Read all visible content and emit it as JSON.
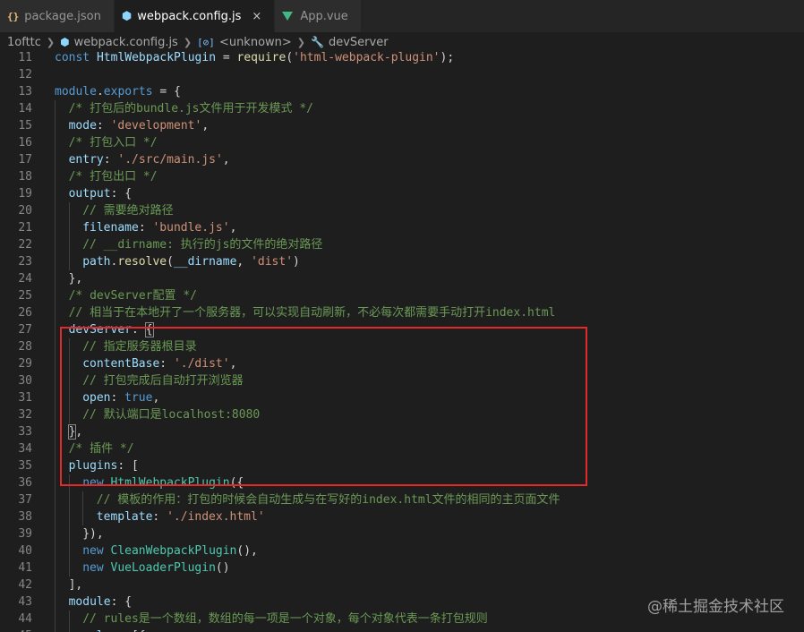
{
  "tabs": [
    {
      "label": "package.json",
      "icon": "json-icon",
      "active": false
    },
    {
      "label": "webpack.config.js",
      "icon": "webpack-icon",
      "active": true
    },
    {
      "label": "App.vue",
      "icon": "vue-icon",
      "active": false
    }
  ],
  "icons": {
    "json_glyph": "{}",
    "webpack_glyph": "⬢",
    "unknown_glyph": "[⊘]",
    "wrench_glyph": "🔧",
    "close_glyph": "×"
  },
  "breadcrumbs": [
    "1ofttc",
    "webpack.config.js",
    "<unknown>",
    "devServer"
  ],
  "colors": {
    "background": "#1e1e1e",
    "keyword": "#569cd6",
    "string": "#ce9178",
    "comment": "#6a9955",
    "class": "#4ec9b0",
    "function": "#dcdcaa",
    "highlight_box": "#e32a2a"
  },
  "code_lines": [
    {
      "n": "11",
      "indent": 0,
      "tokens": [
        [
          "kw",
          "const "
        ],
        [
          "var",
          "HtmlWebpackPlugin"
        ],
        [
          "p",
          " = "
        ],
        [
          "fn",
          "require"
        ],
        [
          "p",
          "("
        ],
        [
          "str",
          "'html-webpack-plugin'"
        ],
        [
          "p",
          ");"
        ]
      ]
    },
    {
      "n": "12",
      "indent": 0,
      "tokens": []
    },
    {
      "n": "13",
      "indent": 0,
      "tokens": [
        [
          "kw",
          "module"
        ],
        [
          "p",
          "."
        ],
        [
          "kw",
          "exports"
        ],
        [
          "p",
          " = {"
        ]
      ]
    },
    {
      "n": "14",
      "indent": 1,
      "tokens": [
        [
          "cm",
          "/* 打包后的bundle.js文件用于开发模式 */"
        ]
      ]
    },
    {
      "n": "15",
      "indent": 1,
      "tokens": [
        [
          "prop",
          "mode"
        ],
        [
          "p",
          ": "
        ],
        [
          "str",
          "'development'"
        ],
        [
          "p",
          ","
        ]
      ]
    },
    {
      "n": "16",
      "indent": 1,
      "tokens": [
        [
          "cm",
          "/* 打包入口 */"
        ]
      ]
    },
    {
      "n": "17",
      "indent": 1,
      "tokens": [
        [
          "prop",
          "entry"
        ],
        [
          "p",
          ": "
        ],
        [
          "str",
          "'./src/main.js'"
        ],
        [
          "p",
          ","
        ]
      ]
    },
    {
      "n": "18",
      "indent": 1,
      "tokens": [
        [
          "cm",
          "/* 打包出口 */"
        ]
      ]
    },
    {
      "n": "19",
      "indent": 1,
      "tokens": [
        [
          "prop",
          "output"
        ],
        [
          "p",
          ": {"
        ]
      ]
    },
    {
      "n": "20",
      "indent": 2,
      "tokens": [
        [
          "cm",
          "// 需要绝对路径"
        ]
      ]
    },
    {
      "n": "21",
      "indent": 2,
      "tokens": [
        [
          "prop",
          "filename"
        ],
        [
          "p",
          ": "
        ],
        [
          "str",
          "'bundle.js'"
        ],
        [
          "p",
          ","
        ]
      ]
    },
    {
      "n": "22",
      "indent": 2,
      "tokens": [
        [
          "cm",
          "// __dirname: 执行的js的文件的绝对路径"
        ]
      ]
    },
    {
      "n": "23",
      "indent": 2,
      "tokens": [
        [
          "var",
          "path"
        ],
        [
          "p",
          "."
        ],
        [
          "fn",
          "resolve"
        ],
        [
          "p",
          "("
        ],
        [
          "var",
          "__dirname"
        ],
        [
          "p",
          ", "
        ],
        [
          "str",
          "'dist'"
        ],
        [
          "p",
          ")"
        ]
      ]
    },
    {
      "n": "24",
      "indent": 1,
      "tokens": [
        [
          "p",
          "},"
        ]
      ]
    },
    {
      "n": "25",
      "indent": 1,
      "tokens": [
        [
          "cm",
          "/* devServer配置 */"
        ]
      ]
    },
    {
      "n": "26",
      "indent": 1,
      "tokens": [
        [
          "cm",
          "// 相当于在本地开了一个服务器，可以实现自动刷新，不必每次都需要手动打开index.html"
        ]
      ]
    },
    {
      "n": "27",
      "indent": 1,
      "tokens": [
        [
          "prop",
          "devServer"
        ],
        [
          "p",
          ": "
        ],
        [
          "bm",
          "{"
        ]
      ]
    },
    {
      "n": "28",
      "indent": 2,
      "tokens": [
        [
          "cm",
          "// 指定服务器根目录"
        ]
      ]
    },
    {
      "n": "29",
      "indent": 2,
      "tokens": [
        [
          "prop",
          "contentBase"
        ],
        [
          "p",
          ": "
        ],
        [
          "str",
          "'./dist'"
        ],
        [
          "p",
          ","
        ]
      ]
    },
    {
      "n": "30",
      "indent": 2,
      "tokens": [
        [
          "cm",
          "// 打包完成后自动打开浏览器"
        ]
      ]
    },
    {
      "n": "31",
      "indent": 2,
      "tokens": [
        [
          "prop",
          "open"
        ],
        [
          "p",
          ": "
        ],
        [
          "bool",
          "true"
        ],
        [
          "p",
          ","
        ]
      ]
    },
    {
      "n": "32",
      "indent": 2,
      "tokens": [
        [
          "cm",
          "// 默认端口是localhost:8080"
        ]
      ]
    },
    {
      "n": "33",
      "indent": 1,
      "tokens": [
        [
          "bm",
          "}"
        ],
        [
          "p",
          ","
        ]
      ]
    },
    {
      "n": "34",
      "indent": 1,
      "tokens": [
        [
          "cm",
          "/* 插件 */"
        ]
      ]
    },
    {
      "n": "35",
      "indent": 1,
      "tokens": [
        [
          "prop",
          "plugins"
        ],
        [
          "p",
          ": ["
        ]
      ]
    },
    {
      "n": "36",
      "indent": 2,
      "tokens": [
        [
          "kw",
          "new "
        ],
        [
          "cls",
          "HtmlWebpackPlugin"
        ],
        [
          "p",
          "({"
        ]
      ]
    },
    {
      "n": "37",
      "indent": 3,
      "tokens": [
        [
          "cm",
          "// 模板的作用：打包的时候会自动生成与在写好的index.html文件的相同的主页面文件"
        ]
      ]
    },
    {
      "n": "38",
      "indent": 3,
      "tokens": [
        [
          "prop",
          "template"
        ],
        [
          "p",
          ": "
        ],
        [
          "str",
          "'./index.html'"
        ]
      ]
    },
    {
      "n": "39",
      "indent": 2,
      "tokens": [
        [
          "p",
          "}),"
        ]
      ]
    },
    {
      "n": "40",
      "indent": 2,
      "tokens": [
        [
          "kw",
          "new "
        ],
        [
          "cls",
          "CleanWebpackPlugin"
        ],
        [
          "p",
          "(),"
        ]
      ]
    },
    {
      "n": "41",
      "indent": 2,
      "tokens": [
        [
          "kw",
          "new "
        ],
        [
          "cls",
          "VueLoaderPlugin"
        ],
        [
          "p",
          "()"
        ]
      ]
    },
    {
      "n": "42",
      "indent": 1,
      "tokens": [
        [
          "p",
          "],"
        ]
      ]
    },
    {
      "n": "43",
      "indent": 1,
      "tokens": [
        [
          "prop",
          "module"
        ],
        [
          "p",
          ": {"
        ]
      ]
    },
    {
      "n": "44",
      "indent": 2,
      "tokens": [
        [
          "cm",
          "// rules是一个数组，数组的每一项是一个对象，每个对象代表一条打包规则"
        ]
      ]
    },
    {
      "n": "45",
      "indent": 2,
      "tokens": [
        [
          "prop",
          "rules"
        ],
        [
          "p",
          ": [{"
        ]
      ]
    }
  ],
  "watermark": "@稀土掘金技术社区"
}
